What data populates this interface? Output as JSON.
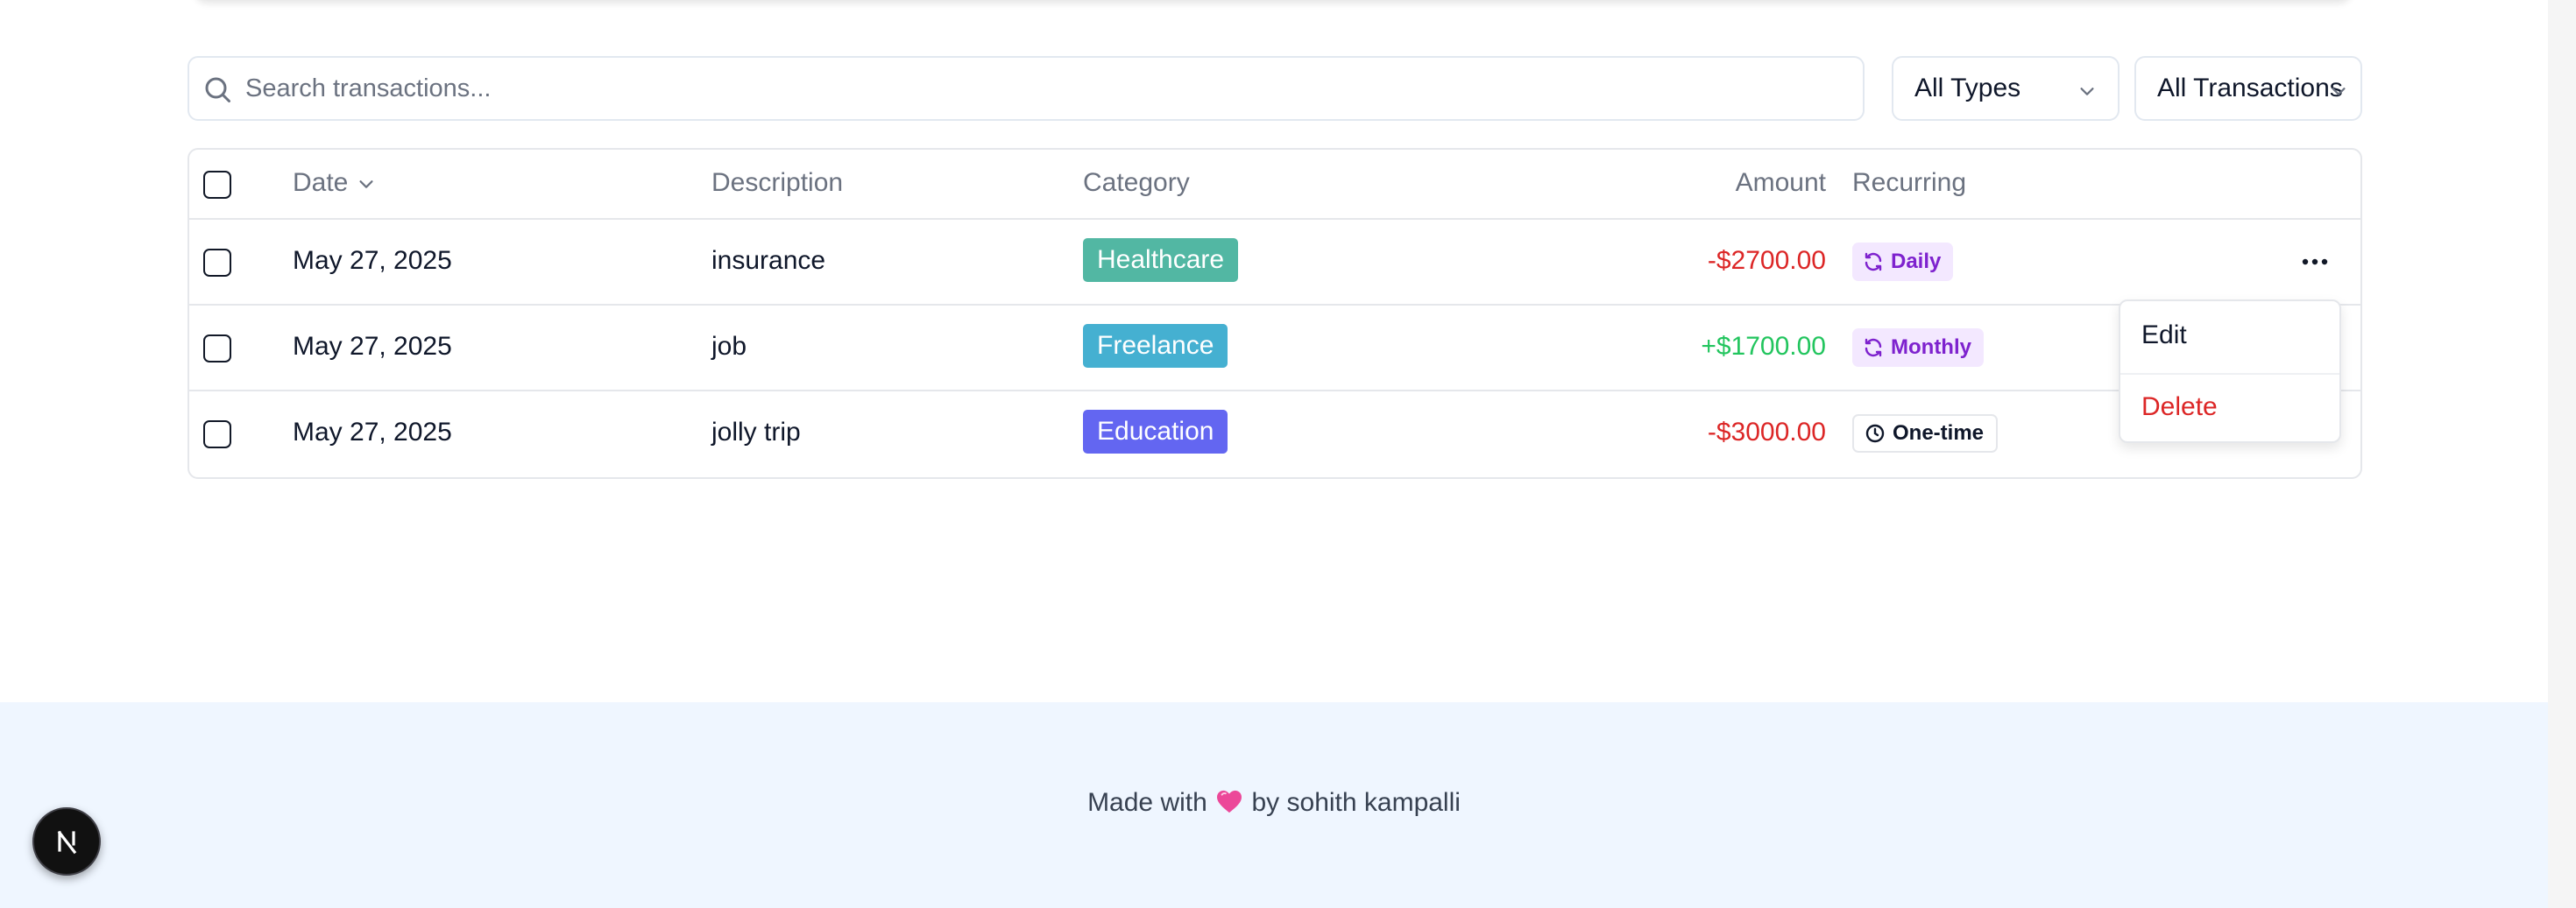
{
  "search": {
    "placeholder": "Search transactions..."
  },
  "filters": {
    "type_label": "All Types",
    "transaction_label": "All Transactions"
  },
  "table": {
    "columns": {
      "date": "Date",
      "description": "Description",
      "category": "Category",
      "amount": "Amount",
      "recurring": "Recurring"
    },
    "rows": [
      {
        "date": "May 27, 2025",
        "description": "insurance",
        "category": "Healthcare",
        "category_color": "#52b7a3",
        "amount": "-$2700.00",
        "recurring": "Daily",
        "recurring_icon": "refresh-icon"
      },
      {
        "date": "May 27, 2025",
        "description": "job",
        "category": "Freelance",
        "category_color": "#45b0d1",
        "amount": "+$1700.00",
        "recurring": "Monthly",
        "recurring_icon": "refresh-icon"
      },
      {
        "date": "May 27, 2025",
        "description": "jolly trip",
        "category": "Education",
        "category_color": "#6366f1",
        "amount": "-$3000.00",
        "recurring": "One-time",
        "recurring_icon": "clock-icon"
      }
    ]
  },
  "row_menu": {
    "edit": "Edit",
    "delete": "Delete"
  },
  "footer": {
    "prefix": "Made with",
    "suffix": "by sohith kampalli"
  },
  "colors": {
    "negative": "#dc2626",
    "positive": "#22c55e",
    "recurring_bg": "#f3e8ff",
    "recurring_text": "#7e22ce",
    "footer_bg": "#eff6ff"
  }
}
